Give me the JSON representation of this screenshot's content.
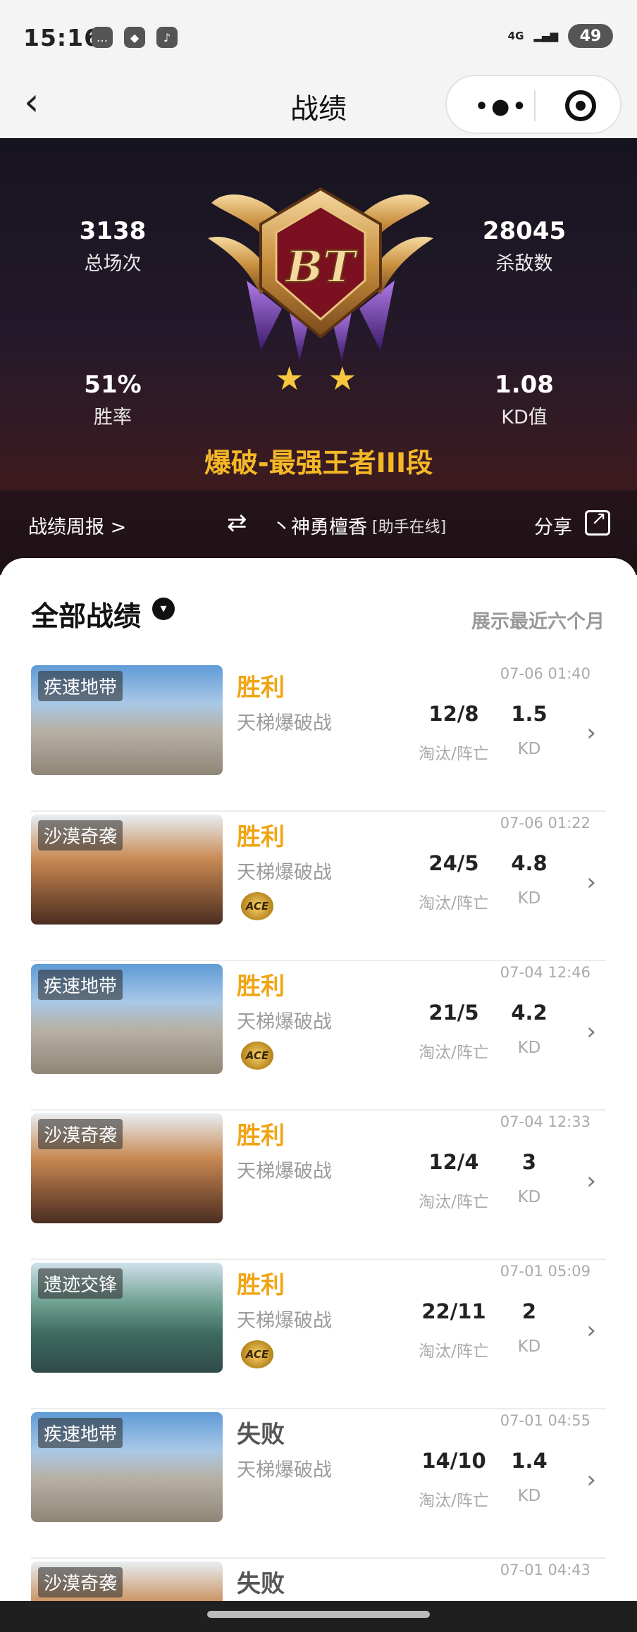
{
  "status": {
    "time": "15:16",
    "network": "4G",
    "battery": "49"
  },
  "nav": {
    "title": "战绩",
    "back_icon": "chevron-left",
    "more_icon": "more-dots",
    "target_icon": "record-target"
  },
  "hero": {
    "total_matches": "3138",
    "total_matches_label": "总场次",
    "kills": "28045",
    "kills_label": "杀敌数",
    "win_rate": "51%",
    "win_rate_label": "胜率",
    "kd": "1.08",
    "kd_label": "KD值",
    "star": "★",
    "rank": "爆破-最强王者III段",
    "weekly": "战绩周报 >",
    "swap": "⇄",
    "player": "丶神勇檀香",
    "assistant": "[助手在线]",
    "share": "分享"
  },
  "section": {
    "title": "全部战绩",
    "note": "展示最近六个月",
    "caret": "▾"
  },
  "labels": {
    "ratio": "淘汰/阵亡",
    "kd": "KD",
    "ace": "ACE",
    "chev": "›"
  },
  "matches": [
    {
      "map": "疾速地带",
      "result": "胜利",
      "mode": "天梯爆破战",
      "date": "07-06 01:40",
      "score": "12/8",
      "kd": "1.5",
      "ace": false
    },
    {
      "map": "沙漠奇袭",
      "result": "胜利",
      "mode": "天梯爆破战",
      "date": "07-06 01:22",
      "score": "24/5",
      "kd": "4.8",
      "ace": true
    },
    {
      "map": "疾速地带",
      "result": "胜利",
      "mode": "天梯爆破战",
      "date": "07-04 12:46",
      "score": "21/5",
      "kd": "4.2",
      "ace": true
    },
    {
      "map": "沙漠奇袭",
      "result": "胜利",
      "mode": "天梯爆破战",
      "date": "07-04 12:33",
      "score": "12/4",
      "kd": "3",
      "ace": false
    },
    {
      "map": "遗迹交锋",
      "result": "胜利",
      "mode": "天梯爆破战",
      "date": "07-01 05:09",
      "score": "22/11",
      "kd": "2",
      "ace": true
    },
    {
      "map": "疾速地带",
      "result": "失败",
      "mode": "天梯爆破战",
      "date": "07-01 04:55",
      "score": "14/10",
      "kd": "1.4",
      "ace": false
    },
    {
      "map": "沙漠奇袭",
      "result": "失败",
      "mode": "",
      "date": "07-01 04:43",
      "score": "",
      "kd": "",
      "ace": false
    }
  ]
}
